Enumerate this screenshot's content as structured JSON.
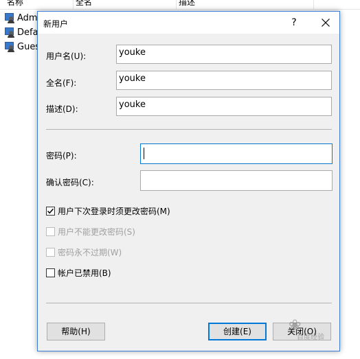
{
  "background": {
    "columns": [
      "名称",
      "全名",
      "描述"
    ],
    "users": [
      "Adm",
      "Defa",
      "Gues"
    ]
  },
  "dialog": {
    "title": "新用户",
    "help_label": "?",
    "fields": {
      "username_label": "用户名(U):",
      "username_value": "youke",
      "fullname_label": "全名(F):",
      "fullname_value": "youke",
      "description_label": "描述(D):",
      "description_value": "youke",
      "password_label": "密码(P):",
      "password_value": "",
      "confirm_label": "确认密码(C):",
      "confirm_value": ""
    },
    "checkboxes": [
      {
        "label": "用户下次登录时须更改密码(M)",
        "checked": true,
        "enabled": true
      },
      {
        "label": "用户不能更改密码(S)",
        "checked": false,
        "enabled": false
      },
      {
        "label": "密码永不过期(W)",
        "checked": false,
        "enabled": false
      },
      {
        "label": "帐户已禁用(B)",
        "checked": false,
        "enabled": true
      }
    ],
    "buttons": {
      "help": "帮助(H)",
      "create": "创建(E)",
      "close": "关闭(O)"
    },
    "colors": {
      "accent": "#0078d7",
      "frame": "#3b7ad7",
      "dialog_bg": "#f0f0f0"
    }
  },
  "watermark": {
    "text": "百度经验"
  }
}
